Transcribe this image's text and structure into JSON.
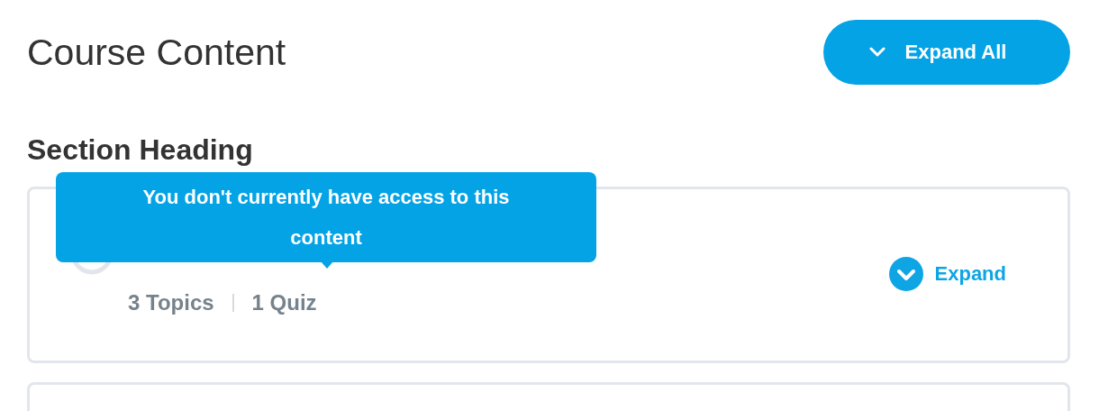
{
  "title": "Course Content",
  "expand_all_button": {
    "label": "Expand All"
  },
  "sections": [
    {
      "heading": "Section Heading",
      "lessons": [
        {
          "tooltip": "You don't currently have access to this content",
          "stats": [
            "3 Topics",
            "1 Quiz"
          ],
          "expand_label": "Expand"
        },
        {
          "kind": "collapsed"
        }
      ]
    }
  ]
}
